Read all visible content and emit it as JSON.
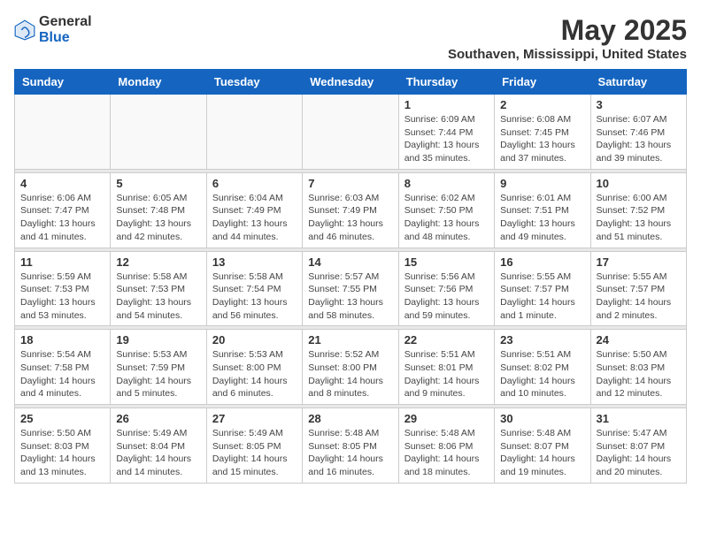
{
  "logo": {
    "text_general": "General",
    "text_blue": "Blue"
  },
  "title": "May 2025",
  "location": "Southaven, Mississippi, United States",
  "days_of_week": [
    "Sunday",
    "Monday",
    "Tuesday",
    "Wednesday",
    "Thursday",
    "Friday",
    "Saturday"
  ],
  "weeks": [
    [
      {
        "day": "",
        "info": ""
      },
      {
        "day": "",
        "info": ""
      },
      {
        "day": "",
        "info": ""
      },
      {
        "day": "",
        "info": ""
      },
      {
        "day": "1",
        "info": "Sunrise: 6:09 AM\nSunset: 7:44 PM\nDaylight: 13 hours and 35 minutes."
      },
      {
        "day": "2",
        "info": "Sunrise: 6:08 AM\nSunset: 7:45 PM\nDaylight: 13 hours and 37 minutes."
      },
      {
        "day": "3",
        "info": "Sunrise: 6:07 AM\nSunset: 7:46 PM\nDaylight: 13 hours and 39 minutes."
      }
    ],
    [
      {
        "day": "4",
        "info": "Sunrise: 6:06 AM\nSunset: 7:47 PM\nDaylight: 13 hours and 41 minutes."
      },
      {
        "day": "5",
        "info": "Sunrise: 6:05 AM\nSunset: 7:48 PM\nDaylight: 13 hours and 42 minutes."
      },
      {
        "day": "6",
        "info": "Sunrise: 6:04 AM\nSunset: 7:49 PM\nDaylight: 13 hours and 44 minutes."
      },
      {
        "day": "7",
        "info": "Sunrise: 6:03 AM\nSunset: 7:49 PM\nDaylight: 13 hours and 46 minutes."
      },
      {
        "day": "8",
        "info": "Sunrise: 6:02 AM\nSunset: 7:50 PM\nDaylight: 13 hours and 48 minutes."
      },
      {
        "day": "9",
        "info": "Sunrise: 6:01 AM\nSunset: 7:51 PM\nDaylight: 13 hours and 49 minutes."
      },
      {
        "day": "10",
        "info": "Sunrise: 6:00 AM\nSunset: 7:52 PM\nDaylight: 13 hours and 51 minutes."
      }
    ],
    [
      {
        "day": "11",
        "info": "Sunrise: 5:59 AM\nSunset: 7:53 PM\nDaylight: 13 hours and 53 minutes."
      },
      {
        "day": "12",
        "info": "Sunrise: 5:58 AM\nSunset: 7:53 PM\nDaylight: 13 hours and 54 minutes."
      },
      {
        "day": "13",
        "info": "Sunrise: 5:58 AM\nSunset: 7:54 PM\nDaylight: 13 hours and 56 minutes."
      },
      {
        "day": "14",
        "info": "Sunrise: 5:57 AM\nSunset: 7:55 PM\nDaylight: 13 hours and 58 minutes."
      },
      {
        "day": "15",
        "info": "Sunrise: 5:56 AM\nSunset: 7:56 PM\nDaylight: 13 hours and 59 minutes."
      },
      {
        "day": "16",
        "info": "Sunrise: 5:55 AM\nSunset: 7:57 PM\nDaylight: 14 hours and 1 minute."
      },
      {
        "day": "17",
        "info": "Sunrise: 5:55 AM\nSunset: 7:57 PM\nDaylight: 14 hours and 2 minutes."
      }
    ],
    [
      {
        "day": "18",
        "info": "Sunrise: 5:54 AM\nSunset: 7:58 PM\nDaylight: 14 hours and 4 minutes."
      },
      {
        "day": "19",
        "info": "Sunrise: 5:53 AM\nSunset: 7:59 PM\nDaylight: 14 hours and 5 minutes."
      },
      {
        "day": "20",
        "info": "Sunrise: 5:53 AM\nSunset: 8:00 PM\nDaylight: 14 hours and 6 minutes."
      },
      {
        "day": "21",
        "info": "Sunrise: 5:52 AM\nSunset: 8:00 PM\nDaylight: 14 hours and 8 minutes."
      },
      {
        "day": "22",
        "info": "Sunrise: 5:51 AM\nSunset: 8:01 PM\nDaylight: 14 hours and 9 minutes."
      },
      {
        "day": "23",
        "info": "Sunrise: 5:51 AM\nSunset: 8:02 PM\nDaylight: 14 hours and 10 minutes."
      },
      {
        "day": "24",
        "info": "Sunrise: 5:50 AM\nSunset: 8:03 PM\nDaylight: 14 hours and 12 minutes."
      }
    ],
    [
      {
        "day": "25",
        "info": "Sunrise: 5:50 AM\nSunset: 8:03 PM\nDaylight: 14 hours and 13 minutes."
      },
      {
        "day": "26",
        "info": "Sunrise: 5:49 AM\nSunset: 8:04 PM\nDaylight: 14 hours and 14 minutes."
      },
      {
        "day": "27",
        "info": "Sunrise: 5:49 AM\nSunset: 8:05 PM\nDaylight: 14 hours and 15 minutes."
      },
      {
        "day": "28",
        "info": "Sunrise: 5:48 AM\nSunset: 8:05 PM\nDaylight: 14 hours and 16 minutes."
      },
      {
        "day": "29",
        "info": "Sunrise: 5:48 AM\nSunset: 8:06 PM\nDaylight: 14 hours and 18 minutes."
      },
      {
        "day": "30",
        "info": "Sunrise: 5:48 AM\nSunset: 8:07 PM\nDaylight: 14 hours and 19 minutes."
      },
      {
        "day": "31",
        "info": "Sunrise: 5:47 AM\nSunset: 8:07 PM\nDaylight: 14 hours and 20 minutes."
      }
    ]
  ]
}
